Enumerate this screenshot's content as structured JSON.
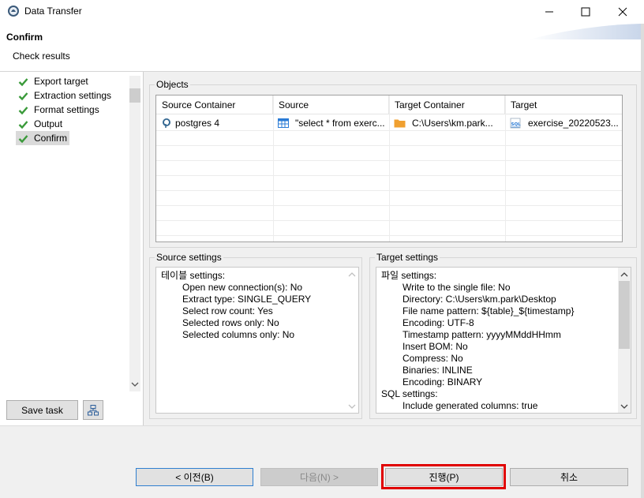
{
  "window": {
    "title": "Data Transfer"
  },
  "header": {
    "title": "Confirm",
    "subtitle": "Check results"
  },
  "nav": {
    "items": [
      {
        "label": "Export target"
      },
      {
        "label": "Extraction settings"
      },
      {
        "label": "Format settings"
      },
      {
        "label": "Output"
      },
      {
        "label": "Confirm"
      }
    ],
    "save_task_label": "Save task"
  },
  "objects": {
    "label": "Objects",
    "columns": [
      "Source Container",
      "Source",
      "Target Container",
      "Target"
    ],
    "rows": [
      {
        "source_container": "postgres 4",
        "source": "\"select * from exerc...",
        "target_container": "C:\\Users\\km.park...",
        "target": "exercise_20220523..."
      }
    ]
  },
  "source_settings": {
    "label": "Source settings",
    "lines": [
      "테이블 settings:",
      "Open new connection(s): No",
      "Extract type: SINGLE_QUERY",
      "Select row count: Yes",
      "Selected rows only: No",
      "Selected columns only: No"
    ]
  },
  "target_settings": {
    "label": "Target settings",
    "lines": [
      "파일 settings:",
      "Write to the single file: No",
      "Directory: C:\\Users\\km.park\\Desktop",
      "File name pattern: ${table}_${timestamp}",
      "Encoding: UTF-8",
      "Timestamp pattern: yyyyMMddHHmm",
      "Insert BOM: No",
      "Compress: No",
      "Binaries: INLINE",
      "Encoding: BINARY",
      "SQL settings:",
      "Include generated columns: true"
    ]
  },
  "buttons": {
    "back": "< 이전(B)",
    "next": "다음(N) >",
    "proceed": "진행(P)",
    "cancel": "취소"
  },
  "colors": {
    "check": "#3a9a3a",
    "highlight_border": "#e00000",
    "focus_border": "#2f7fd0",
    "folder": "#f0a030",
    "sql_icon": "#2a7bd6"
  }
}
